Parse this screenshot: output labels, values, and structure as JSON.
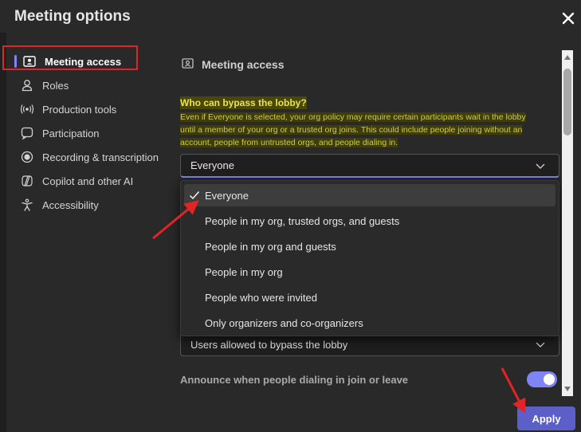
{
  "dialog": {
    "title": "Meeting options"
  },
  "sidebar": {
    "items": [
      {
        "label": "Meeting access",
        "icon": "meeting-access-icon",
        "active": true
      },
      {
        "label": "Roles",
        "icon": "person-icon"
      },
      {
        "label": "Production tools",
        "icon": "broadcast-icon"
      },
      {
        "label": "Participation",
        "icon": "chat-icon"
      },
      {
        "label": "Recording & transcription",
        "icon": "record-icon"
      },
      {
        "label": "Copilot and other AI",
        "icon": "copilot-icon"
      },
      {
        "label": "Accessibility",
        "icon": "accessibility-icon"
      }
    ]
  },
  "main": {
    "section_title": "Meeting access",
    "lobby": {
      "question": "Who can bypass the lobby?",
      "desc_line1": "Even if Everyone is selected, your org policy may require certain participants wait in the lobby",
      "desc_line2": "until a member of your org or a trusted org joins. This could include people joining without an",
      "desc_line3": "account, people from untrusted orgs, and people dialing in.",
      "selected_value": "Everyone",
      "options": [
        "Everyone",
        "People in my org, trusted orgs, and guests",
        "People in my org and guests",
        "People in my org",
        "People who were invited",
        "Only organizers and co-organizers"
      ]
    },
    "second_select_value": "Users allowed to bypass the lobby",
    "announce_label": "Announce when people dialing in join or leave",
    "announce_on": true
  },
  "footer": {
    "apply_label": "Apply"
  },
  "colors": {
    "accent": "#7f85f5",
    "annotation_red": "#e22424",
    "highlight": "#4a4808"
  }
}
